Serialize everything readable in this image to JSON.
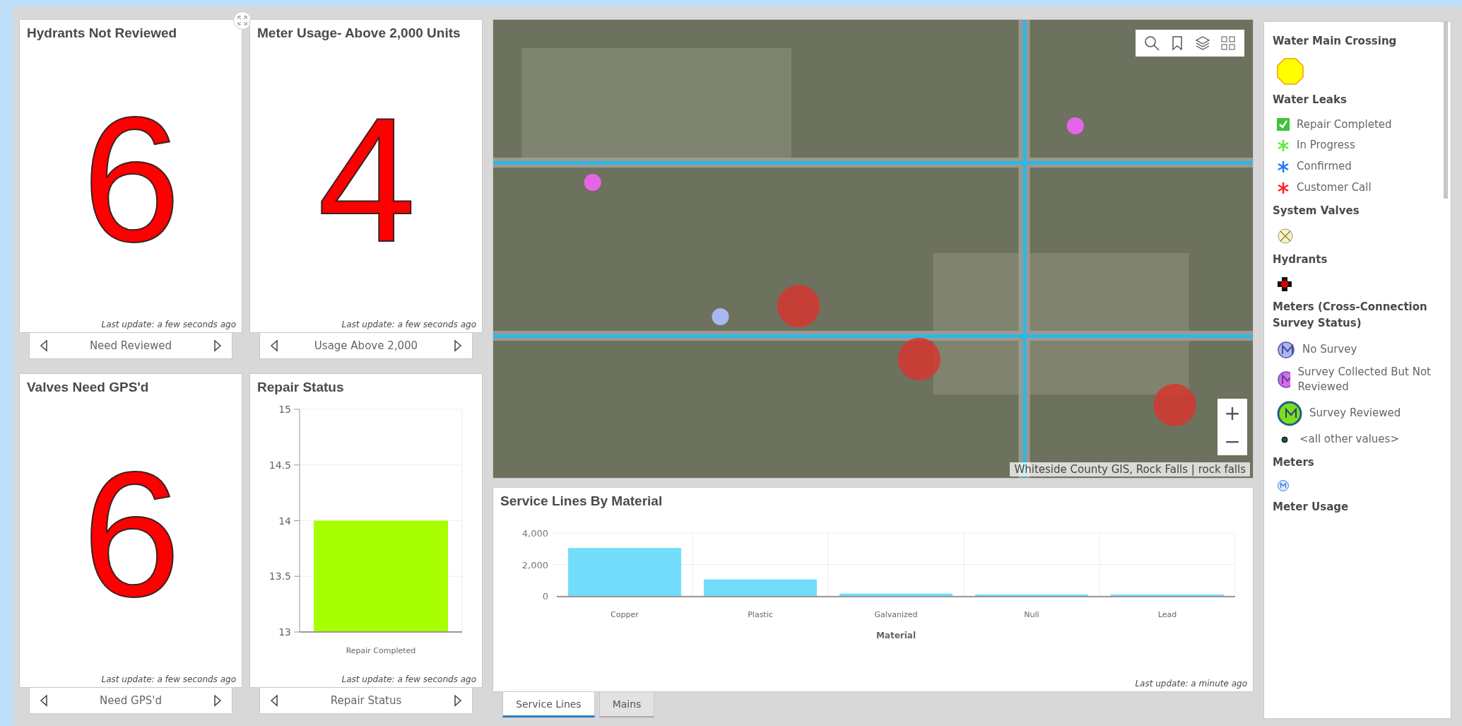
{
  "indicators": [
    {
      "title": "Hydrants Not Reviewed",
      "value": "6",
      "updated": "Last update: a few seconds ago",
      "nav_label": "Need Reviewed",
      "expand": true
    },
    {
      "title": "Meter Usage- Above 2,000 Units",
      "value": "4",
      "updated": "Last update: a few seconds ago",
      "nav_label": "Usage Above 2,000",
      "expand": false
    }
  ],
  "bottom_indicator": {
    "title": "Valves Need GPS'd",
    "value": "6",
    "updated": "Last update: a few seconds ago",
    "nav_label": "Need GPS'd",
    "expand": false
  },
  "repair_status": {
    "title": "Repair Status",
    "updated": "Last update: a few seconds ago",
    "nav_label": "Repair Status",
    "chart_data": {
      "type": "bar",
      "categories": [
        "Repair Completed"
      ],
      "series": [
        {
          "color": "#a8ff00",
          "values": [
            14
          ]
        }
      ],
      "grid": true,
      "ylim": [
        13,
        15
      ],
      "yticks": [
        13,
        13.5,
        14,
        14.5,
        15
      ]
    }
  },
  "map": {
    "attribution": "Whiteside County GIS, Rock Falls | rock falls",
    "zoom_in": "+",
    "zoom_out": "−"
  },
  "service_lines": {
    "title": "Service Lines By Material",
    "updated": "Last update: a minute ago",
    "chart_data": {
      "type": "bar",
      "xlabel": "Material",
      "categories": [
        "Copper",
        "Plastic",
        "Galvanized",
        "Null",
        "Lead"
      ],
      "series": [
        {
          "color": "#72dcfb",
          "values": [
            3050,
            1050,
            150,
            90,
            90
          ]
        }
      ],
      "grid": true,
      "ylim": [
        0,
        4000
      ],
      "yticks": [
        {
          "value": 0,
          "label": "0"
        },
        {
          "value": 2000,
          "label": "2,000"
        },
        {
          "value": 4000,
          "label": "4,000"
        }
      ]
    }
  },
  "tabs": [
    {
      "label": "Service Lines",
      "selected": true
    },
    {
      "label": "Mains",
      "selected": false
    }
  ],
  "legend": [
    {
      "title": "Water Main Crossing",
      "items": [
        {
          "kind": "octagon"
        }
      ]
    },
    {
      "title": "Water Leaks",
      "items": [
        {
          "kind": "check",
          "label": "Repair Completed"
        },
        {
          "kind": "asterisk",
          "label": "In Progress",
          "color": "#55ee33"
        },
        {
          "kind": "asterisk",
          "label": "Confirmed",
          "color": "#2277ff"
        },
        {
          "kind": "asterisk",
          "label": "Customer Call",
          "color": "#ff2222"
        }
      ]
    },
    {
      "title": "System Valves",
      "items": [
        {
          "kind": "valve"
        }
      ]
    },
    {
      "title": "Hydrants",
      "items": [
        {
          "kind": "hydrant"
        }
      ]
    },
    {
      "title": "Meters (Cross-Connection Survey Status)",
      "items": [
        {
          "kind": "meter",
          "label": "No Survey",
          "color": "#a9b9ef"
        },
        {
          "kind": "meter",
          "label": "Survey Collected But Not Reviewed",
          "color": "#e565e8"
        },
        {
          "kind": "meter",
          "label": "Survey Reviewed",
          "color": "#7fdc1f"
        },
        {
          "kind": "dot",
          "label": "<all other values>"
        }
      ]
    },
    {
      "title": "Meters",
      "items": [
        {
          "kind": "minimeter"
        }
      ]
    },
    {
      "title": "Meter Usage"
    }
  ]
}
